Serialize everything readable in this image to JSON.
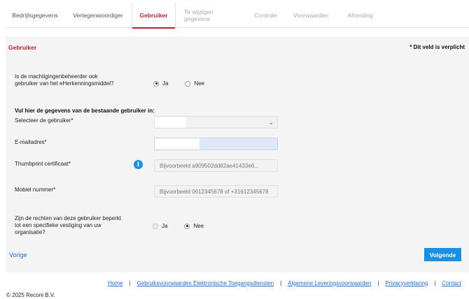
{
  "tabs": [
    {
      "label": "Bedrijfsgegevens",
      "state": "normal"
    },
    {
      "label": "Vertegenwoordiger",
      "state": "normal"
    },
    {
      "label": "Gebruiker",
      "state": "active"
    },
    {
      "label": "Te wijzigen gegevens",
      "state": "disabled"
    },
    {
      "label": "Controle",
      "state": "disabled"
    },
    {
      "label": "Voorwaarden",
      "state": "disabled"
    },
    {
      "label": "Afronding",
      "state": "disabled"
    }
  ],
  "panel": {
    "title": "Gebruiker",
    "required_note": "* Dit veld is verplicht"
  },
  "question1": {
    "label": "Is de machtigingenbeheerder ook gebruiker van het eHerkenningsmiddel?",
    "options": {
      "yes": "Ja",
      "no": "Nee"
    },
    "selected": "yes"
  },
  "section_heading": "Vul hier de gegevens van de bestaande gebruiker in:",
  "fields": {
    "user_select": {
      "label": "Selecteer de gebruiker*",
      "value": ""
    },
    "email": {
      "label": "E-mailadres*",
      "value": ""
    },
    "thumbprint": {
      "label": "Thumbprint certificaat*",
      "placeholder": "Bijvoorbeeld a909502dd82ae41433e6..."
    },
    "mobile": {
      "label": "Mobiel nummer*",
      "placeholder": "Bijvoorbeeld 0612345678 of +31612345678"
    }
  },
  "question2": {
    "label": "Zijn de rechten van deze gebruiker beperkt tot een specifieke vestiging van uw organisatie?",
    "options": {
      "yes": "Ja",
      "no": "Nee"
    },
    "selected": "no"
  },
  "nav": {
    "prev": "Vorige",
    "next": "Volgende"
  },
  "footer": {
    "links": [
      "Home",
      "Gebruiksvoorwaarden Elektronische Toegangsdiensten",
      "Algemene Leveringsvoorwaarden",
      "Privacyverklaring",
      "Contact"
    ],
    "separator": "|",
    "copyright": "© 2025 Reconi B.V."
  },
  "colors": {
    "accent": "#b4232f",
    "primary": "#1b8fe0",
    "link": "#1b6bd0"
  }
}
